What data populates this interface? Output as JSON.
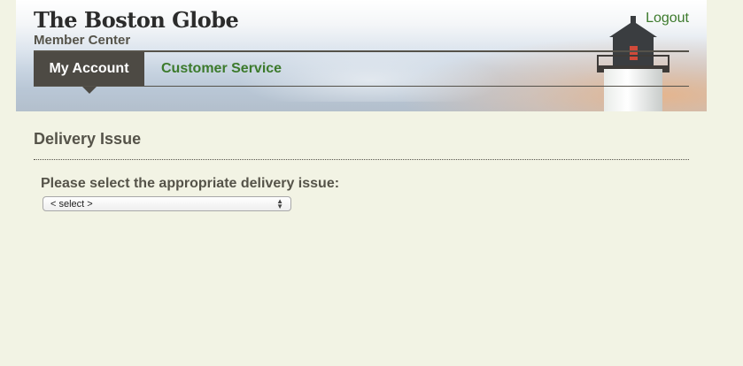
{
  "header": {
    "logo_text": "The Boston Globe",
    "subtitle": "Member Center",
    "logout_label": "Logout"
  },
  "nav": {
    "tabs": [
      {
        "label": "My Account",
        "active": true
      },
      {
        "label": "Customer Service",
        "active": false
      }
    ]
  },
  "main": {
    "title": "Delivery Issue",
    "prompt": "Please select the appropriate delivery issue:",
    "select": {
      "selected": "< select >"
    }
  },
  "icons": {
    "select_arrows": "chevron-up-down-icon",
    "header_image": "lighthouse-icon"
  },
  "colors": {
    "accent_green": "#3c7a2c",
    "tab_active_bg": "#4d4a44",
    "page_bg": "#f2f3e4",
    "heading_text": "#555349"
  }
}
